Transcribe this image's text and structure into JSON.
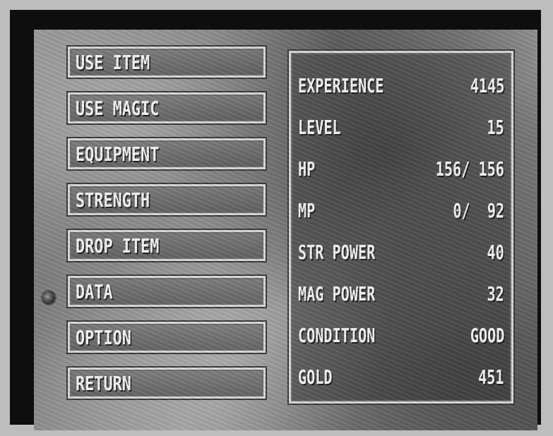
{
  "menu": {
    "items": [
      {
        "label": "USE ITEM"
      },
      {
        "label": "USE MAGIC"
      },
      {
        "label": "EQUIPMENT"
      },
      {
        "label": "STRENGTH"
      },
      {
        "label": "DROP ITEM"
      },
      {
        "label": "DATA"
      },
      {
        "label": "OPTION"
      },
      {
        "label": "RETURN"
      }
    ],
    "selected": "DATA"
  },
  "stats": {
    "rows": [
      {
        "label": "EXPERIENCE",
        "value": "4145"
      },
      {
        "label": "LEVEL",
        "value": "15"
      },
      {
        "label": "HP",
        "value": "156/ 156"
      },
      {
        "label": "MP",
        "value": "0/  92"
      },
      {
        "label": "STR POWER",
        "value": "40"
      },
      {
        "label": "MAG POWER",
        "value": "32"
      },
      {
        "label": "CONDITION",
        "value": "GOOD"
      },
      {
        "label": "GOLD",
        "value": "451"
      }
    ]
  },
  "icons": {
    "cursor": "selection-orb-icon"
  }
}
